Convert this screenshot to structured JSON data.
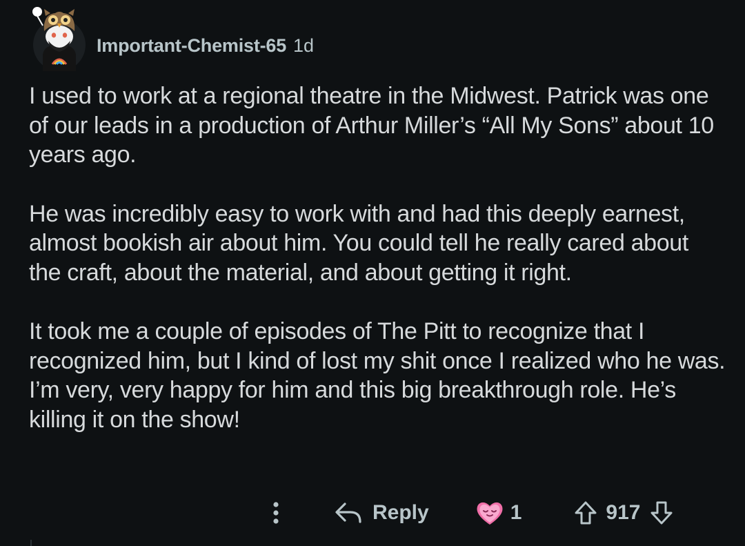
{
  "comment": {
    "author": "Important-Chemist-65",
    "age": "1d",
    "paragraphs": [
      "I used to work at a regional theatre in the Midwest. Patrick was one of our leads in a production of Arthur Miller’s “All My Sons” about 10 years ago.",
      "He was incredibly easy to work with and had this deeply earnest, almost bookish air about him. You could tell he really cared about the craft, about the material, and about getting it right.",
      "It took me a couple of episodes of The Pitt to recognize that I recognized him, but I kind of lost my shit once I realized who he was. I’m very, very happy for him and this big breakthrough role. He’s killing it on the show!"
    ]
  },
  "actions": {
    "more_icon": "more-vertical-icon",
    "reply_label": "Reply",
    "reply_icon": "reply-arrow-icon",
    "award_icon": "heart-face-award-icon",
    "award_count": "1",
    "upvote_icon": "upvote-arrow-icon",
    "score": "917",
    "downvote_icon": "downvote-arrow-icon"
  },
  "colors": {
    "background": "#0e1113",
    "text": "#d7dadc",
    "meta": "#b8c5c9",
    "award": "#f06fa8"
  }
}
